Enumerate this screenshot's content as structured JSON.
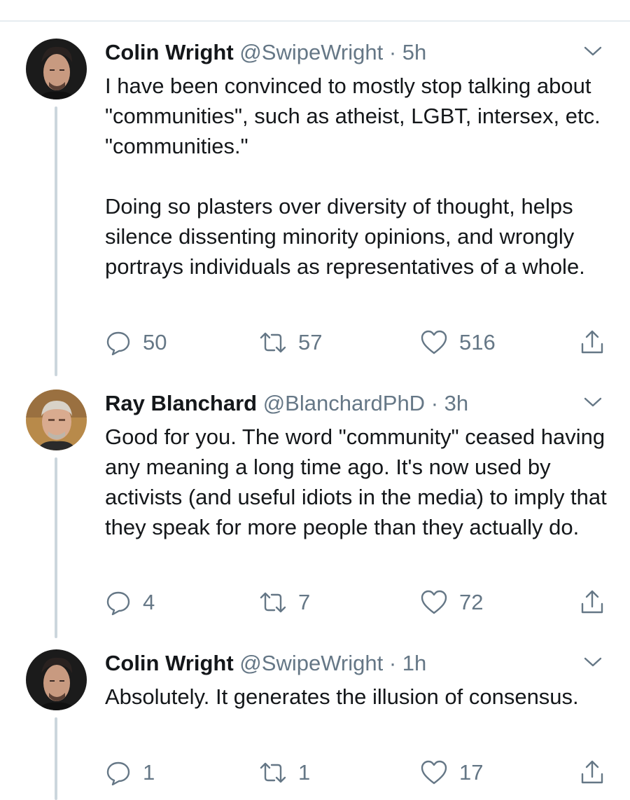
{
  "tweets": [
    {
      "name": "Colin Wright",
      "handle": "@SwipeWright",
      "separator": "·",
      "time": "5h",
      "text": "I have been convinced to mostly stop talking about \"communities\", such as atheist, LGBT, intersex, etc. \"communities.\"\n\nDoing so plasters over diversity of thought, helps silence dissenting minority opinions, and wrongly portrays individuals as representatives of a whole.",
      "replies": "50",
      "retweets": "57",
      "likes": "516"
    },
    {
      "name": "Ray Blanchard",
      "handle": "@BlanchardPhD",
      "separator": "·",
      "time": "3h",
      "text": "Good for you. The word \"community\" ceased having any meaning a long time ago. It's now used by activists (and useful idiots in the media) to imply that they speak for more people than they actually do.",
      "replies": "4",
      "retweets": "7",
      "likes": "72"
    },
    {
      "name": "Colin Wright",
      "handle": "@SwipeWright",
      "separator": "·",
      "time": "1h",
      "text": "Absolutely. It generates the illusion of consensus.",
      "replies": "1",
      "retweets": "1",
      "likes": "17"
    }
  ],
  "icons": {
    "reply": "reply-icon",
    "retweet": "retweet-icon",
    "like": "heart-icon",
    "share": "share-icon",
    "menu": "chevron-down-icon"
  },
  "colors": {
    "text": "#14171a",
    "secondary": "#657786",
    "thread_line": "#ccd6dd"
  }
}
